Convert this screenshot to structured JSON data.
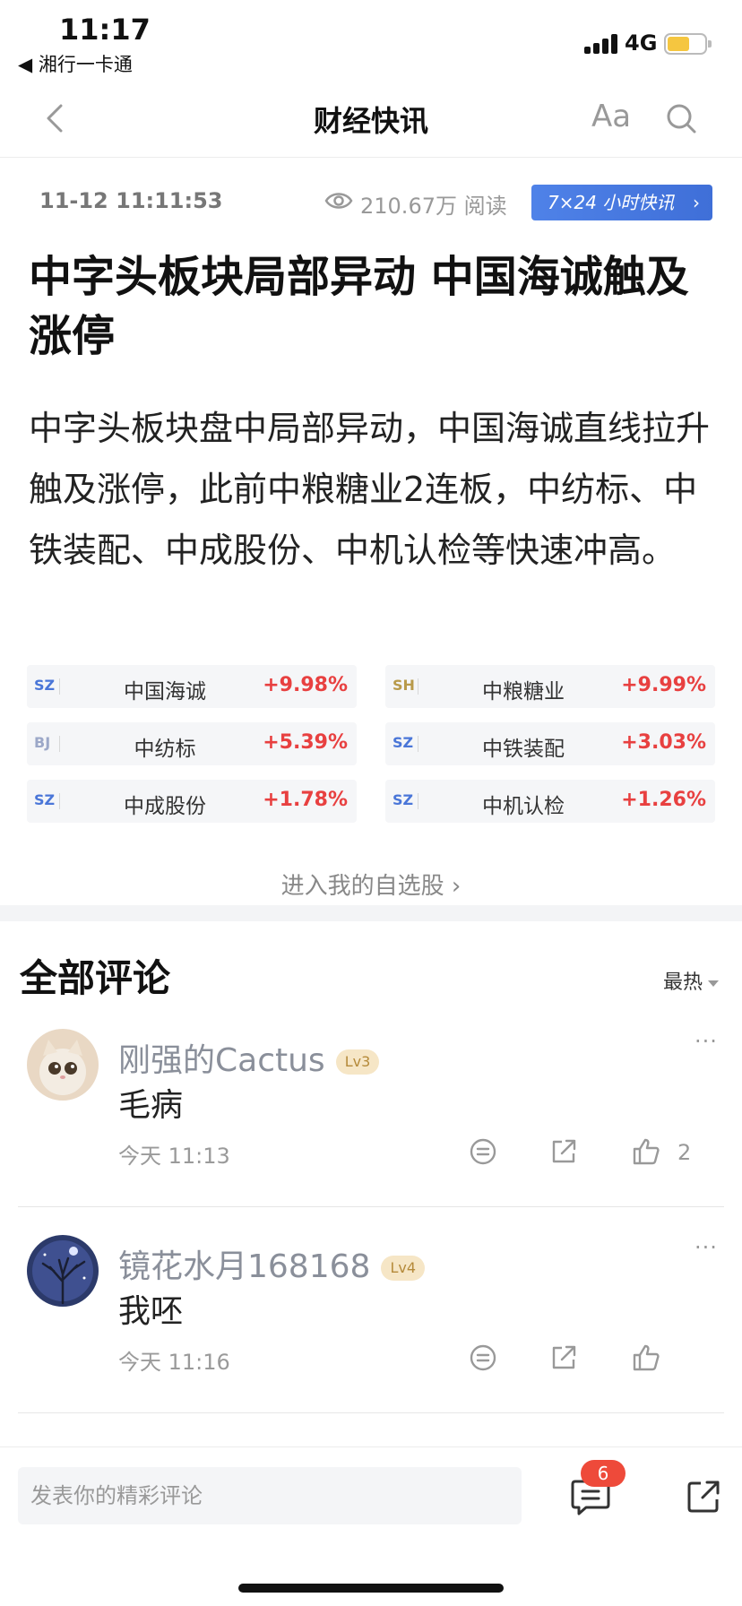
{
  "status_bar": {
    "time": "11:17",
    "back_app": "◀ 湘行一卡通",
    "network": "4G",
    "battery_level": 0.5,
    "battery_color": "#f5c640"
  },
  "nav": {
    "title": "财经快讯",
    "font_label": "Aa",
    "back_icon": "chevron-left-icon",
    "search_icon": "search-icon"
  },
  "meta": {
    "datetime": "11-12 11:11:53",
    "reads": "210.67万 阅读",
    "badge": "7×24 小时快讯",
    "badge_chevron": "›",
    "accent": "#4f82e8"
  },
  "article": {
    "headline": "中字头板块局部异动 中国海诚触及涨停",
    "body": "中字头板块盘中局部异动，中国海诚直线拉升触及涨停，此前中粮糖业2连板，中纺标、中铁装配、中成股份、中机认检等快速冲高。"
  },
  "stocks": [
    {
      "exchange": "SZ",
      "name": "中国海诚",
      "change": "+9.98%"
    },
    {
      "exchange": "SH",
      "name": "中粮糖业",
      "change": "+9.99%"
    },
    {
      "exchange": "BJ",
      "name": "中纺标",
      "change": "+5.39%"
    },
    {
      "exchange": "SZ",
      "name": "中铁装配",
      "change": "+3.03%"
    },
    {
      "exchange": "SZ",
      "name": "中成股份",
      "change": "+1.78%"
    },
    {
      "exchange": "SZ",
      "name": "中机认检",
      "change": "+1.26%"
    }
  ],
  "enter_watchlist": "进入我的自选股 ›",
  "comments_section": {
    "title": "全部评论",
    "sort": "最热",
    "items": [
      {
        "user": "刚强的Cactus",
        "level": "Lv3",
        "text": "毛病",
        "time": "今天 11:13",
        "likes": "2",
        "more": "···"
      },
      {
        "user": "镜花水月168168",
        "level": "Lv4",
        "text": "我呸",
        "time": "今天 11:16",
        "likes": "",
        "more": "···"
      }
    ]
  },
  "bottom_bar": {
    "input_placeholder": "发表你的精彩评论",
    "comment_count": "6"
  }
}
